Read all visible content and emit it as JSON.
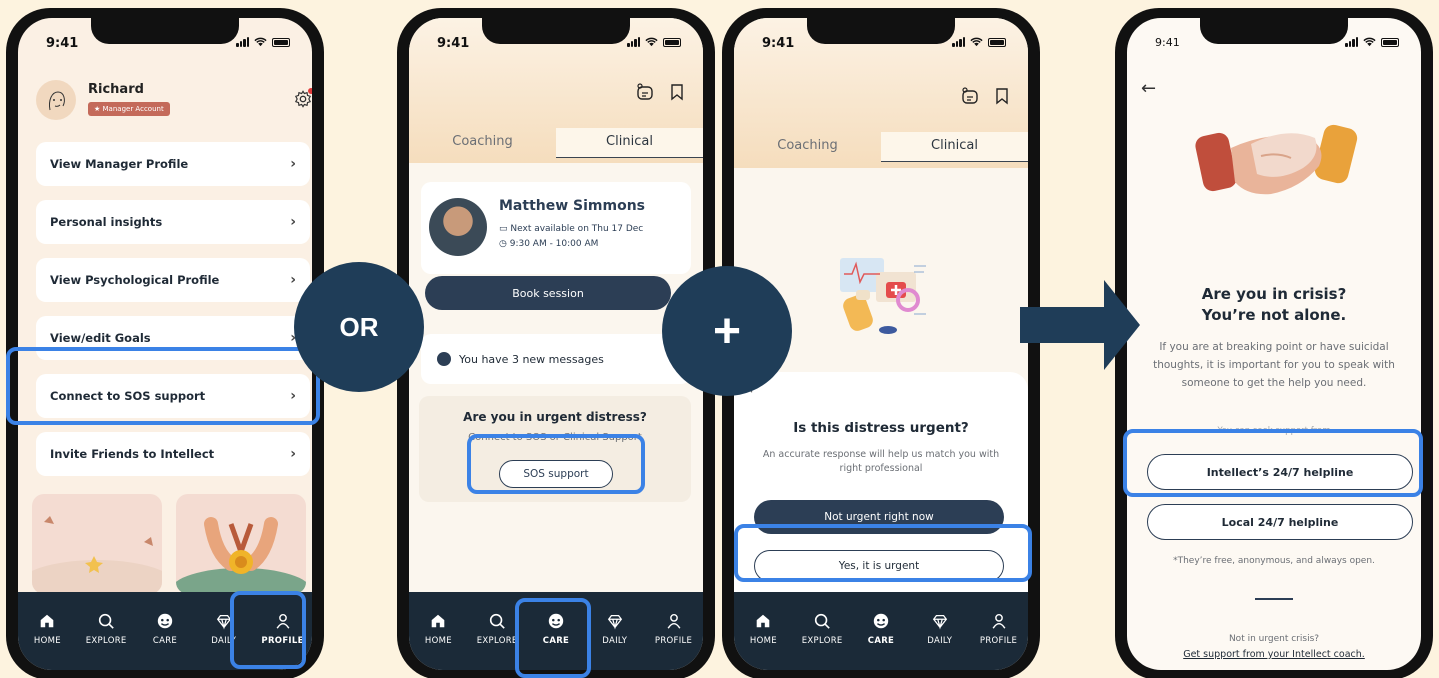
{
  "status": {
    "time": "9:41"
  },
  "phone1": {
    "user_name": "Richard",
    "account_badge": "Manager Account",
    "menu": [
      "View Manager Profile",
      "Personal insights",
      "View Psychological Profile",
      "View/edit Goals",
      "Connect to SOS support",
      "Invite Friends to Intellect"
    ]
  },
  "phone2": {
    "tabs": [
      "Coaching",
      "Clinical"
    ],
    "coach_name": "Matthew Simmons",
    "availability": "Next available on Thu 17 Dec",
    "time_slot": "9:30 AM - 10:00 AM",
    "book_label": "Book session",
    "messages": "You have 3 new messages",
    "urgent_title": "Are you in urgent distress?",
    "urgent_sub": "Connect to SOS or Clinical Support",
    "sos_label": "SOS support"
  },
  "phone3": {
    "tabs": [
      "Coaching",
      "Clinical"
    ],
    "sheet_title": "Is this distress urgent?",
    "sheet_sub": "An accurate response will help us match you with right professional",
    "not_urgent_label": "Not urgent right now",
    "urgent_label": "Yes, it is urgent"
  },
  "phone4": {
    "title_line1": "Are you in crisis?",
    "title_line2": "You’re not alone.",
    "body": "If you are at breaking point or have suicidal thoughts, it is important for you to speak with someone to get the help you need.",
    "seek": "You can seek support from",
    "helpline1": "Intellect’s 24/7 helpline",
    "helpline2": "Local 24/7 helpline",
    "free_note": "*They’re free, anonymous, and always open.",
    "not_urgent": "Not in urgent crisis?",
    "coach_link": "Get support from your Intellect coach."
  },
  "tabbar": [
    "HOME",
    "EXPLORE",
    "CARE",
    "DAILY",
    "PROFILE"
  ],
  "connectors": {
    "or": "OR",
    "plus": "+"
  },
  "colors": {
    "accent": "#3b82e6",
    "navy": "#1f3d58",
    "dark_button": "#2c3e55",
    "background": "#fdf3df"
  }
}
